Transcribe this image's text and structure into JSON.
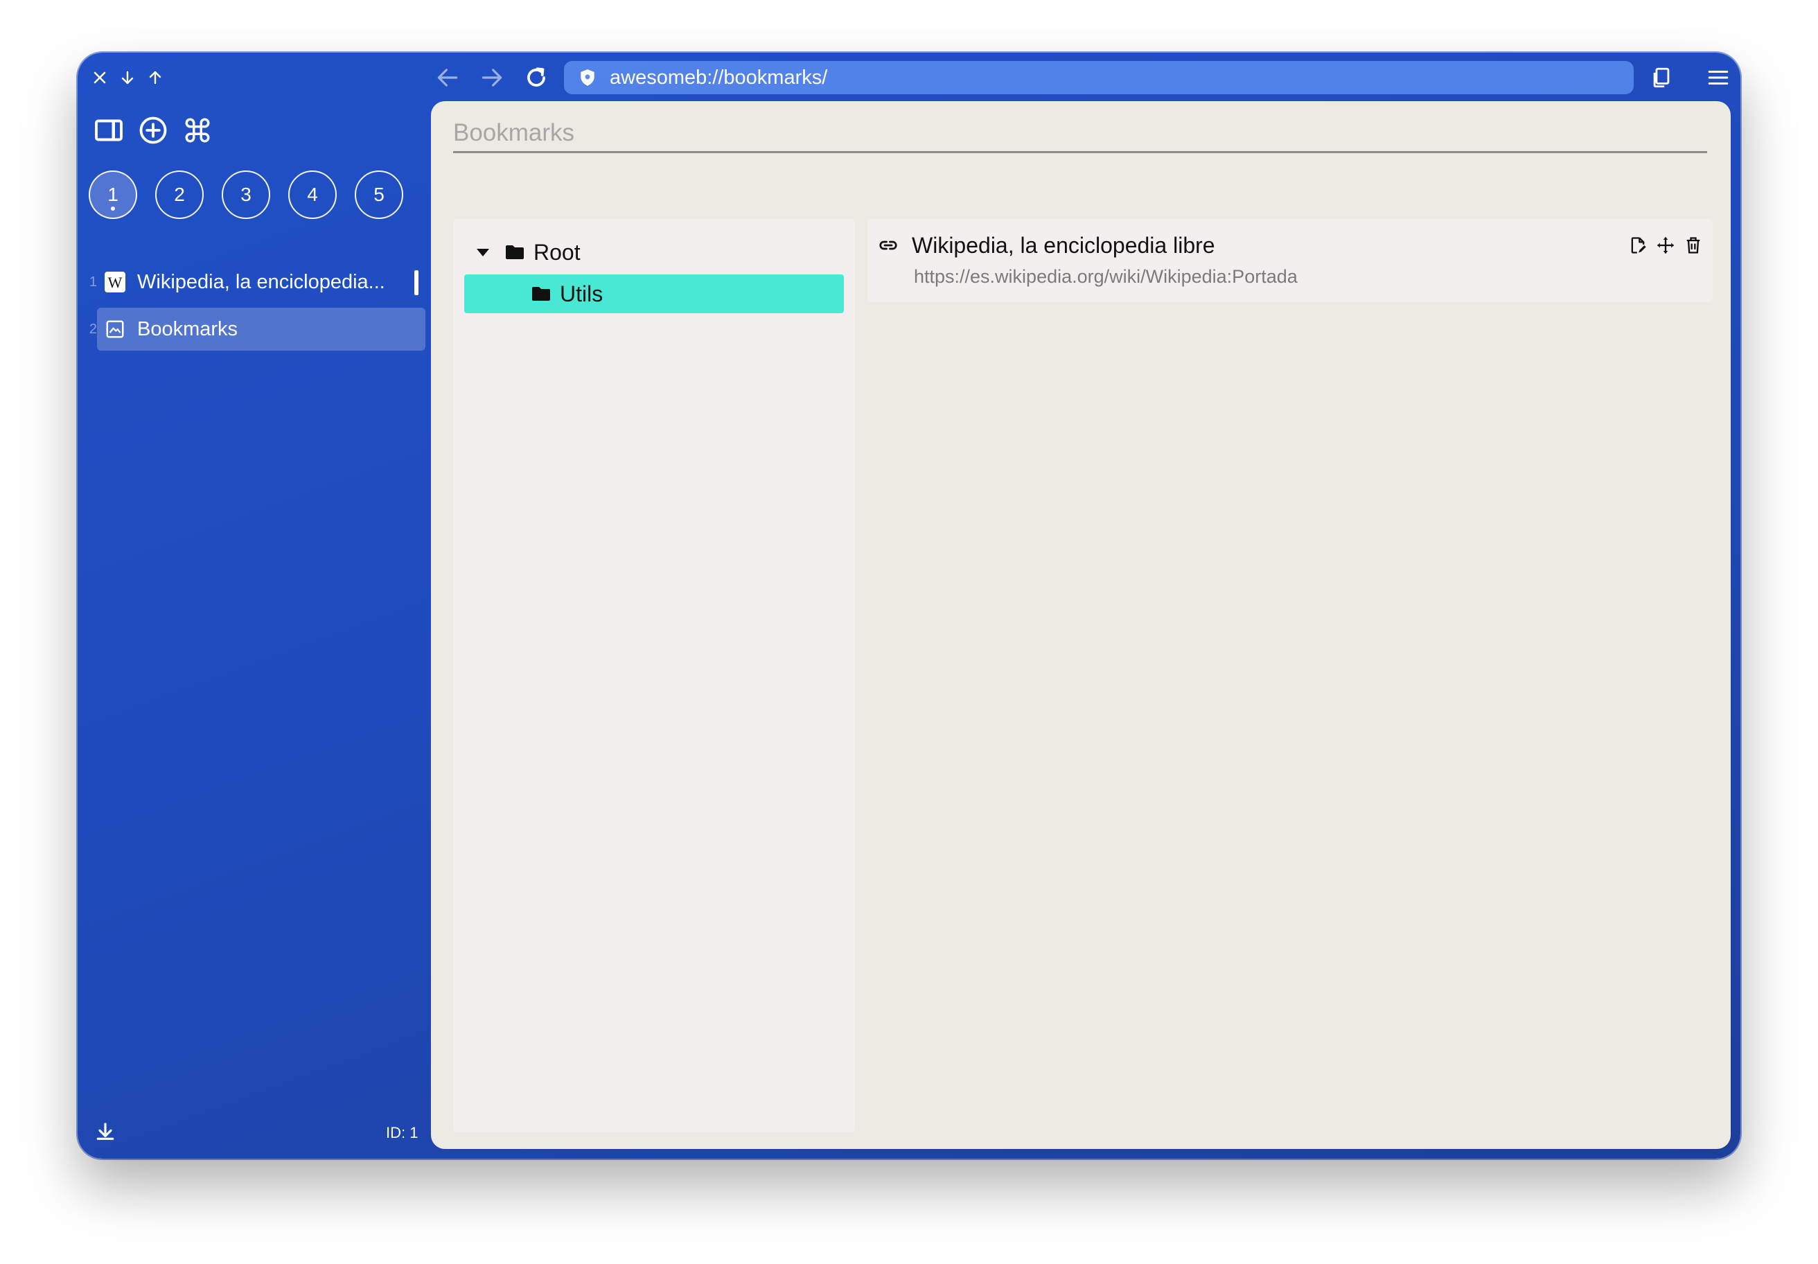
{
  "window": {
    "controls": [
      {
        "name": "close-icon"
      },
      {
        "name": "arrow-down-icon"
      },
      {
        "name": "arrow-up-icon"
      }
    ]
  },
  "navigation": {
    "back_icon": "arrow-left-icon",
    "forward_icon": "arrow-right-icon",
    "reload_icon": "reload-icon",
    "url": "awesomeb://bookmarks/",
    "copy_icon": "copy-icon",
    "menu_icon": "hamburger-menu-icon"
  },
  "sidebar": {
    "tools": [
      "sidebar-toggle-icon",
      "add-circle-icon",
      "command-icon"
    ],
    "workspaces": [
      "1",
      "2",
      "3",
      "4",
      "5"
    ],
    "active_workspace": "1",
    "tabs": [
      {
        "number": "1",
        "title": "Wikipedia, la enciclopedia...",
        "icon": "wikipedia-icon",
        "active": true
      },
      {
        "number": "2",
        "title": "Bookmarks",
        "icon": "image-icon",
        "selected": true
      }
    ],
    "id_label": "ID: 1"
  },
  "page": {
    "title_placeholder": "Bookmarks",
    "tree": [
      {
        "label": "Root",
        "expanded": true,
        "selected": false
      },
      {
        "label": "Utils",
        "selected": true
      }
    ],
    "bookmarks": [
      {
        "title": "Wikipedia, la enciclopedia libre",
        "url": "https://es.wikipedia.org/wiki/Wikipedia:Portada",
        "actions": [
          "edit-icon",
          "move-icon",
          "trash-icon"
        ]
      }
    ]
  },
  "colors": {
    "sidebar_blue": "#2150c6",
    "url_bar": "#5a8cf0",
    "content_bg": "#ede9e3",
    "panel_bg": "#f4efef",
    "selected_folder": "#48e8d4"
  }
}
